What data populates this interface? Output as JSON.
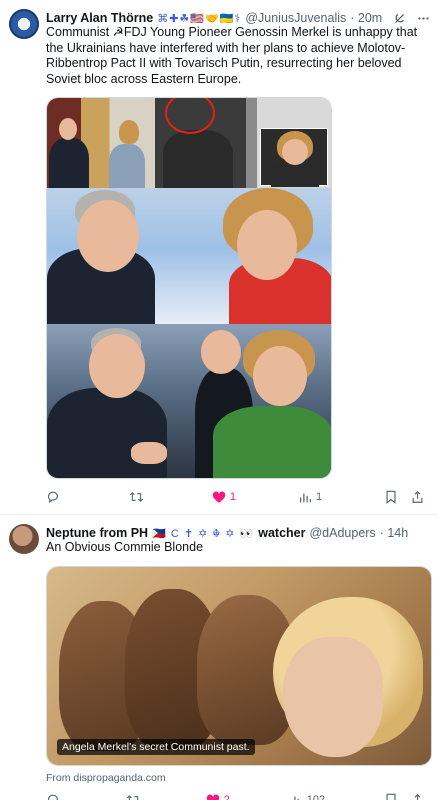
{
  "posts": [
    {
      "author": {
        "display_name": "Larry Alan Thörne",
        "badges": "⌘✚☘︎🇺🇸🤝🇺🇦⚕",
        "handle": "@JuniusJuvenalis",
        "time": "· 20m"
      },
      "text": "Communist ☭FDJ Young Pioneer Genossin Merkel is unhappy that the Ukrainians have interfered with her plans to achieve Molotov-Ribbentrop Pact II with Tovarisch Putin, resurrecting her beloved Soviet bloc across Eastern Europe.",
      "actions": {
        "reply": "",
        "repost": "",
        "like": "1",
        "views": "1"
      }
    },
    {
      "author": {
        "display_name": "Neptune from PH",
        "badges": "🇵🇭 C ✝ ✡ ☬ ✡ 👀",
        "handle_prefix": "watcher",
        "handle": "@dAdupers",
        "time": "· 14h"
      },
      "text": "An Obvious Commie Blonde",
      "media_caption": "Angela Merkel's secret Communist past.",
      "source": "From dispropaganda.com",
      "actions": {
        "reply": "",
        "repost": "",
        "like": "2",
        "views": "102"
      }
    }
  ],
  "icons": {
    "grok": "grok-icon",
    "more": "more-icon",
    "reply": "reply-icon",
    "repost": "repost-icon",
    "like": "heart-icon",
    "views": "views-icon",
    "bookmark": "bookmark-icon",
    "share": "share-icon"
  },
  "colors": {
    "text": "#0f1419",
    "secondary": "#536471",
    "like": "#f91880",
    "border": "#cfd9de"
  }
}
